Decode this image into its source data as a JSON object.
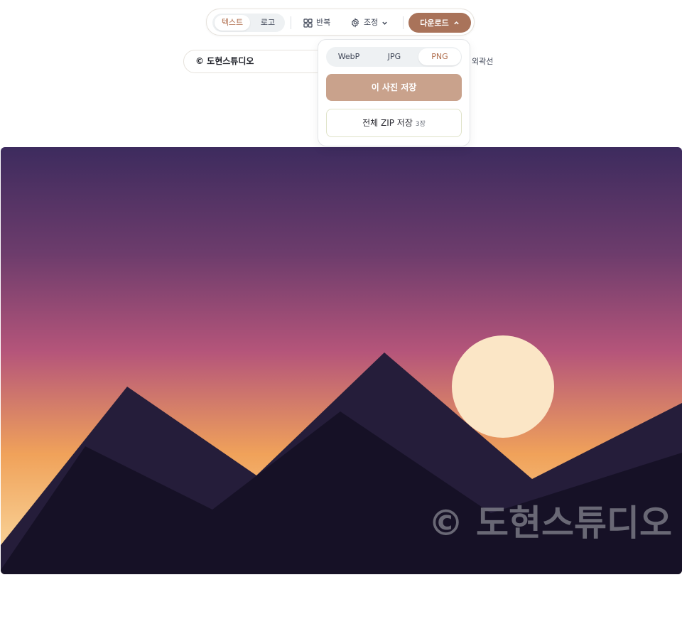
{
  "toolbar": {
    "mode_tabs": [
      {
        "label": "텍스트",
        "active": true
      },
      {
        "label": "로고",
        "active": false
      }
    ],
    "repeat_label": "반복",
    "adjust_label": "조정",
    "download_label": "다운로드"
  },
  "text_input": {
    "value": "© 도현스튜디오"
  },
  "outline_label": "외곽선",
  "download_menu": {
    "formats": [
      {
        "label": "WebP",
        "active": false
      },
      {
        "label": "JPG",
        "active": false
      },
      {
        "label": "PNG",
        "active": true
      }
    ],
    "save_one_label": "이 사진 저장",
    "save_zip_label": "전체 ZIP 저장",
    "save_zip_count": "3장"
  },
  "canvas": {
    "watermark_text": "© 도현스튜디오",
    "colors": {
      "sky_top": "#3d2b5e",
      "sky_mid": "#b5557a",
      "sky_low": "#f0a25a",
      "sky_bottom": "#fbe0a8",
      "sun": "#fbe6c6",
      "mountain_back": "#251d3a",
      "mountain_front": "#161126"
    }
  },
  "colors": {
    "accent": "#a9735a",
    "accent_light": "#c9a28c",
    "active_tab_text": "#b06d4c"
  }
}
